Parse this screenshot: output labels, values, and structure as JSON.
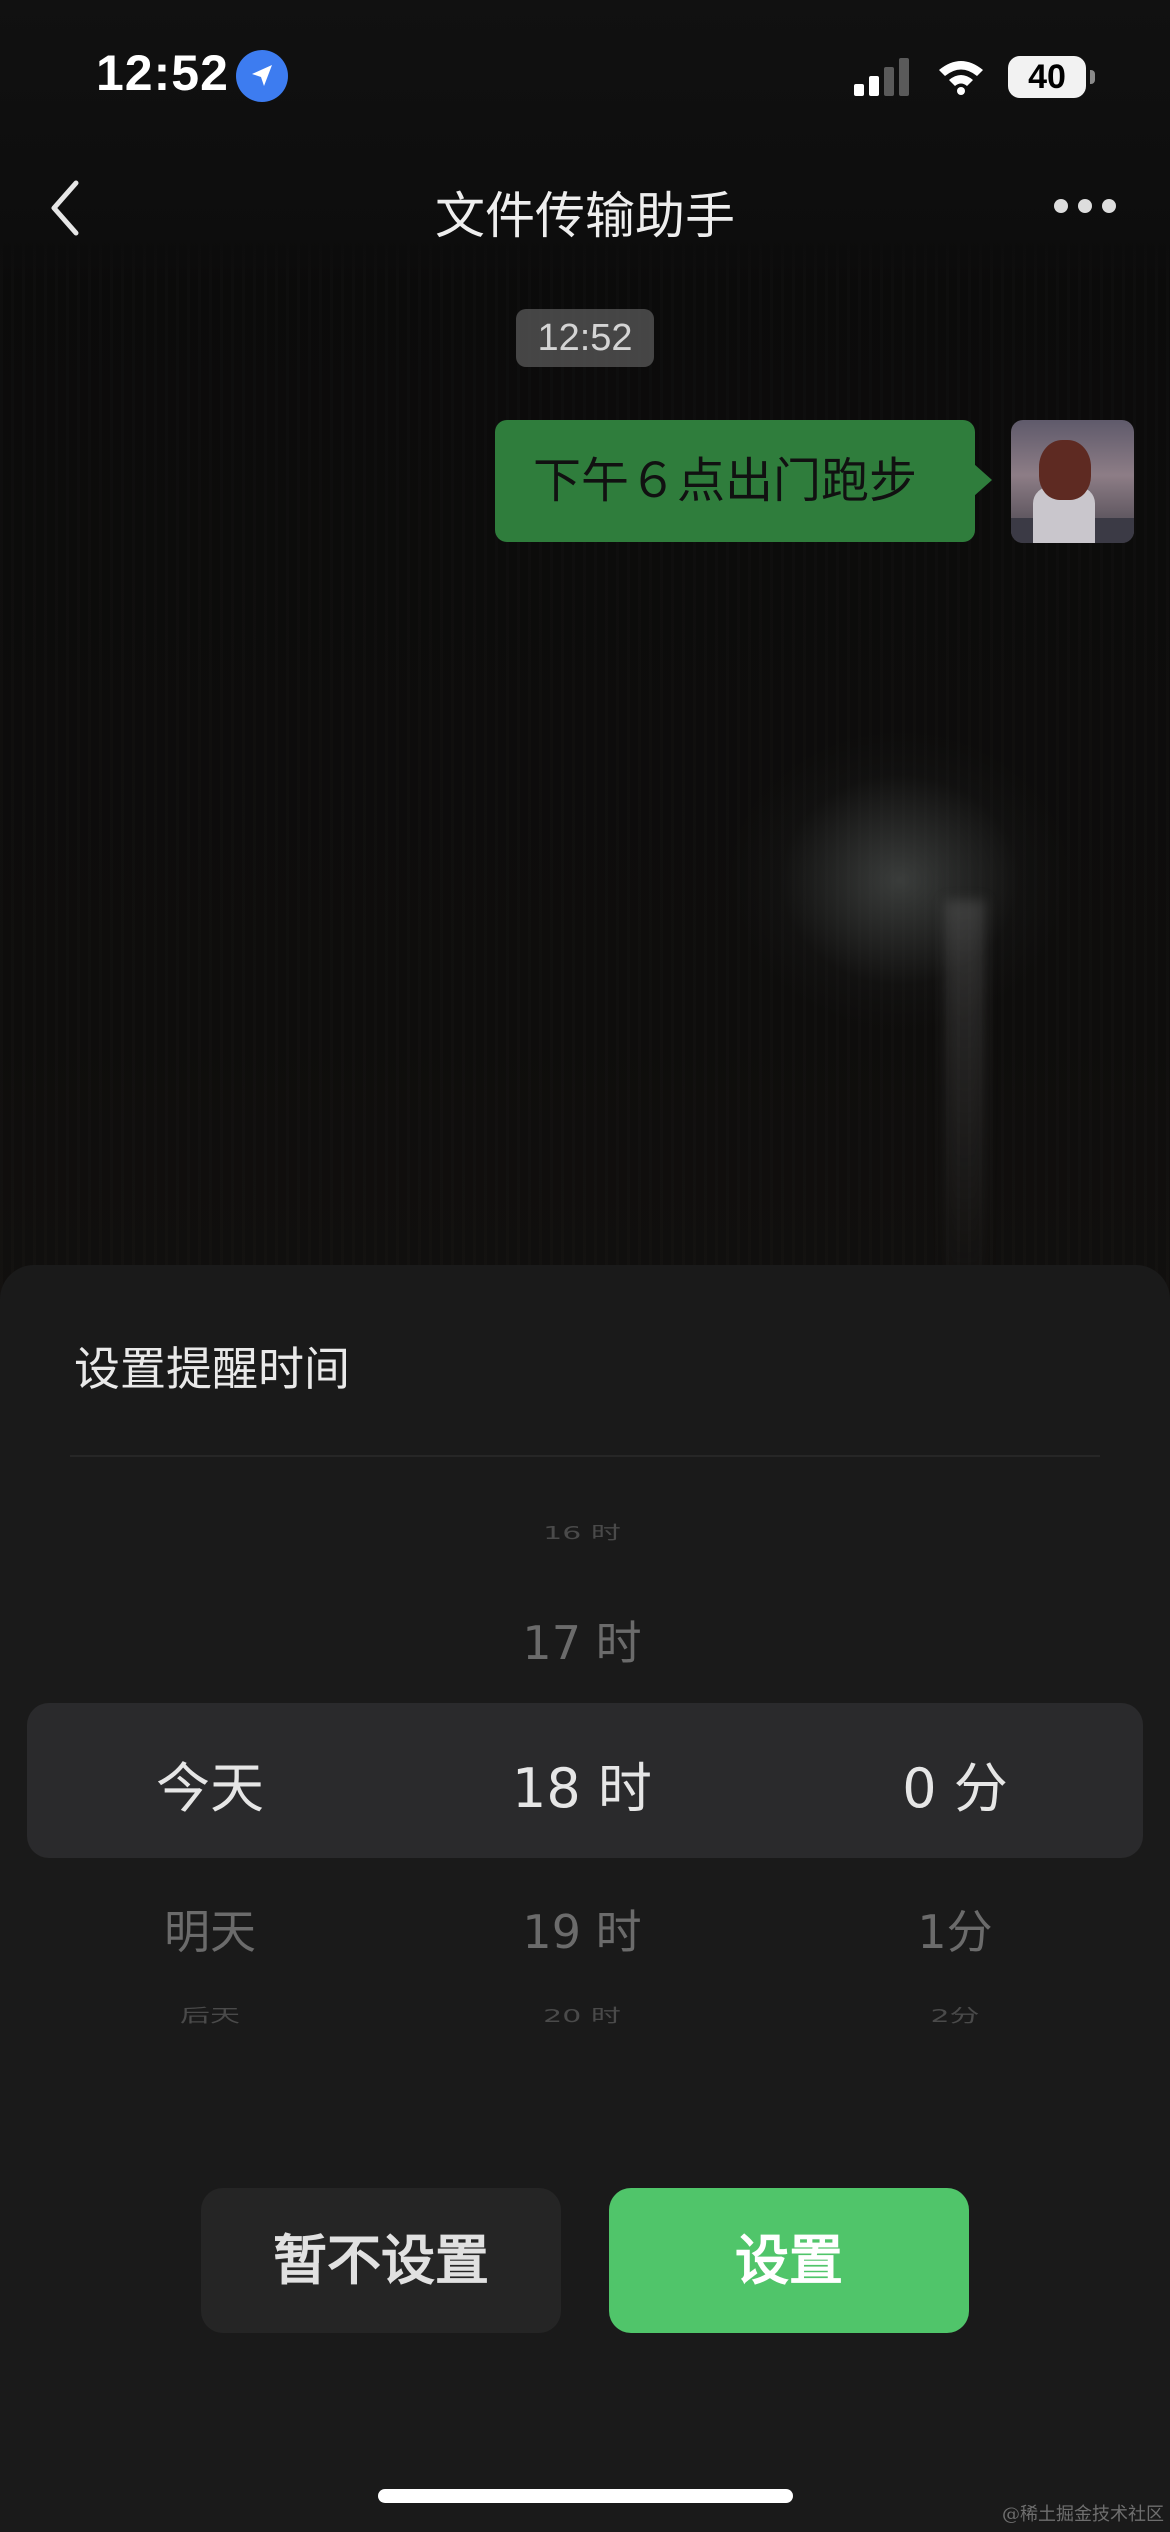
{
  "status_bar": {
    "time": "12:52",
    "battery": "40"
  },
  "nav": {
    "title": "文件传输助手"
  },
  "chat": {
    "timestamp": "12:52",
    "messages": [
      {
        "text": "下午６点出门跑步"
      }
    ]
  },
  "reminder_sheet": {
    "title": "设置提醒时间",
    "picker": {
      "day": {
        "above": [],
        "selected": "今天",
        "below": [
          "明天",
          "后天"
        ]
      },
      "hour": {
        "above": [
          "16 时",
          "17 时"
        ],
        "selected": "18 时",
        "below": [
          "19 时",
          "20 时"
        ]
      },
      "minute": {
        "above": [],
        "selected": "0 分",
        "below": [
          "1分",
          "2分"
        ]
      }
    },
    "buttons": {
      "cancel": "暂不设置",
      "confirm": "设置"
    },
    "colors": {
      "confirm": "#50c56a",
      "bubble": "#2f7d3c"
    }
  },
  "watermark": "@稀土掘金技术社区"
}
